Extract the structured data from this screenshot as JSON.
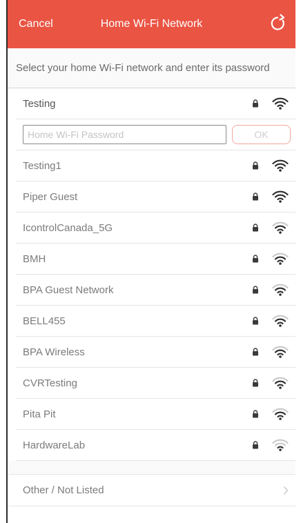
{
  "header": {
    "cancel_label": "Cancel",
    "title": "Home Wi-Fi Network",
    "refresh_icon": "refresh-icon"
  },
  "instruction": "Select your home Wi-Fi network and enter its password",
  "selected_network": {
    "name": "Testing",
    "password_placeholder": "Home Wi-Fi Password",
    "password_value": "",
    "ok_label": "OK"
  },
  "networks": [
    {
      "name": "Testing1",
      "secured": true,
      "signal": 4
    },
    {
      "name": "Piper Guest",
      "secured": true,
      "signal": 4
    },
    {
      "name": "IcontrolCanada_5G",
      "secured": true,
      "signal": 3
    },
    {
      "name": "BMH",
      "secured": true,
      "signal": 3
    },
    {
      "name": "BPA Guest Network",
      "secured": true,
      "signal": 3
    },
    {
      "name": "BELL455",
      "secured": true,
      "signal": 3
    },
    {
      "name": "BPA Wireless",
      "secured": true,
      "signal": 3
    },
    {
      "name": "CVRTesting",
      "secured": true,
      "signal": 3
    },
    {
      "name": "Pita Pit",
      "secured": true,
      "signal": 3
    },
    {
      "name": "HardwareLab",
      "secured": true,
      "signal": 2
    }
  ],
  "other_label": "Other / Not Listed",
  "colors": {
    "accent": "#ea5443",
    "ok_border": "#f2a79f",
    "wifi_strong": "#2e2e2e",
    "wifi_weak": "#c9c9c9"
  }
}
